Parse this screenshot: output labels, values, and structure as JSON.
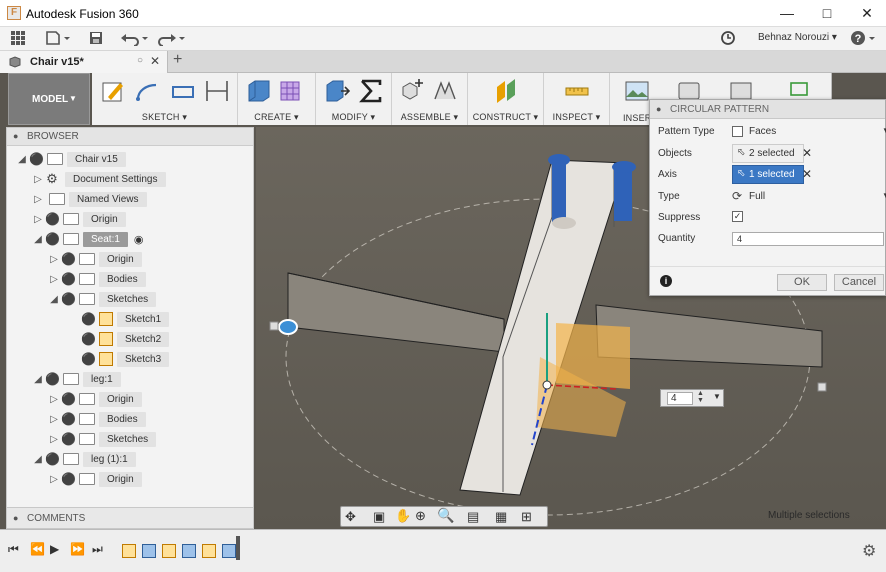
{
  "window": {
    "title": "Autodesk Fusion 360",
    "app_icon": "F"
  },
  "qat": {
    "user": "Behnaz Norouzi"
  },
  "tab": {
    "label": "Chair v15*"
  },
  "toolbar": {
    "workspace": "MODEL",
    "groups": {
      "sketch": "SKETCH",
      "create": "CREATE",
      "modify": "MODIFY",
      "assemble": "ASSEMBLE",
      "construct": "CONSTRUCT",
      "inspect": "INSPECT",
      "insert": "INSERT"
    }
  },
  "browser": {
    "title": "BROWSER",
    "items": {
      "root": "Chair v15",
      "doc_settings": "Document Settings",
      "named_views": "Named Views",
      "origin": "Origin",
      "seat": "Seat:1",
      "seat_origin": "Origin",
      "seat_bodies": "Bodies",
      "seat_sketches": "Sketches",
      "sketch1": "Sketch1",
      "sketch2": "Sketch2",
      "sketch3": "Sketch3",
      "leg1": "leg:1",
      "leg1_origin": "Origin",
      "leg1_bodies": "Bodies",
      "leg1_sketches": "Sketches",
      "leg11": "leg (1):1",
      "leg11_origin": "Origin"
    }
  },
  "comments": {
    "title": "COMMENTS"
  },
  "panel": {
    "title": "CIRCULAR PATTERN",
    "pattern_type_label": "Pattern Type",
    "pattern_type_value": "Faces",
    "objects_label": "Objects",
    "objects_value": "2 selected",
    "axis_label": "Axis",
    "axis_value": "1 selected",
    "type_label": "Type",
    "type_value": "Full",
    "suppress_label": "Suppress",
    "quantity_label": "Quantity",
    "quantity_value": "4",
    "ok": "OK",
    "cancel": "Cancel"
  },
  "viewport": {
    "quantity_manip": "4",
    "status": "Multiple selections"
  }
}
